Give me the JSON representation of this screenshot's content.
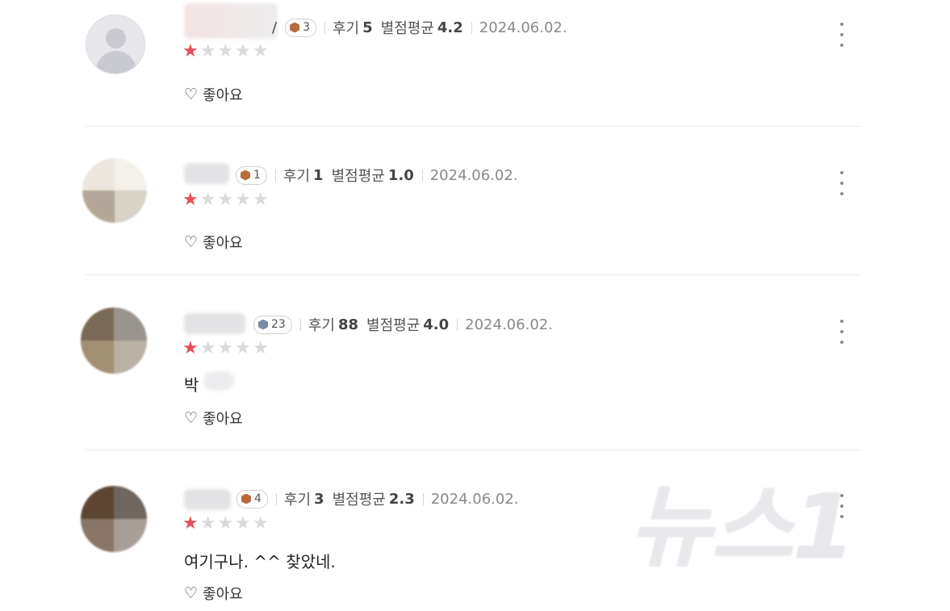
{
  "labels": {
    "review_count_label": "후기",
    "avg_rating_label": "별점평균",
    "like_label": "좋아요"
  },
  "reviews": [
    {
      "badge_level": "3",
      "badge_color": "#b86a3a",
      "review_count": "5",
      "avg_rating": "4.2",
      "date": "2024.06.02.",
      "stars": "1",
      "comment": "",
      "name_suffix": "/"
    },
    {
      "badge_level": "1",
      "badge_color": "#b86a3a",
      "review_count": "1",
      "avg_rating": "1.0",
      "date": "2024.06.02.",
      "stars": "1",
      "comment": "",
      "name_suffix": ""
    },
    {
      "badge_level": "23",
      "badge_color": "#7a8aa6",
      "review_count": "88",
      "avg_rating": "4.0",
      "date": "2024.06.02.",
      "stars": "1",
      "comment": "박",
      "name_suffix": ""
    },
    {
      "badge_level": "4",
      "badge_color": "#b86a3a",
      "review_count": "3",
      "avg_rating": "2.3",
      "date": "2024.06.02.",
      "stars": "1",
      "comment": "여기구나. ^^ 찾았네.",
      "name_suffix": ""
    }
  ],
  "watermark": {
    "logo": "뉴스1"
  },
  "colors": {
    "star_on": "#e94e56",
    "star_off": "#dadada"
  },
  "icons": {
    "like": "heart-outline-icon",
    "more": "kebab-menu-icon",
    "badge": "hexagon-badge-icon"
  }
}
